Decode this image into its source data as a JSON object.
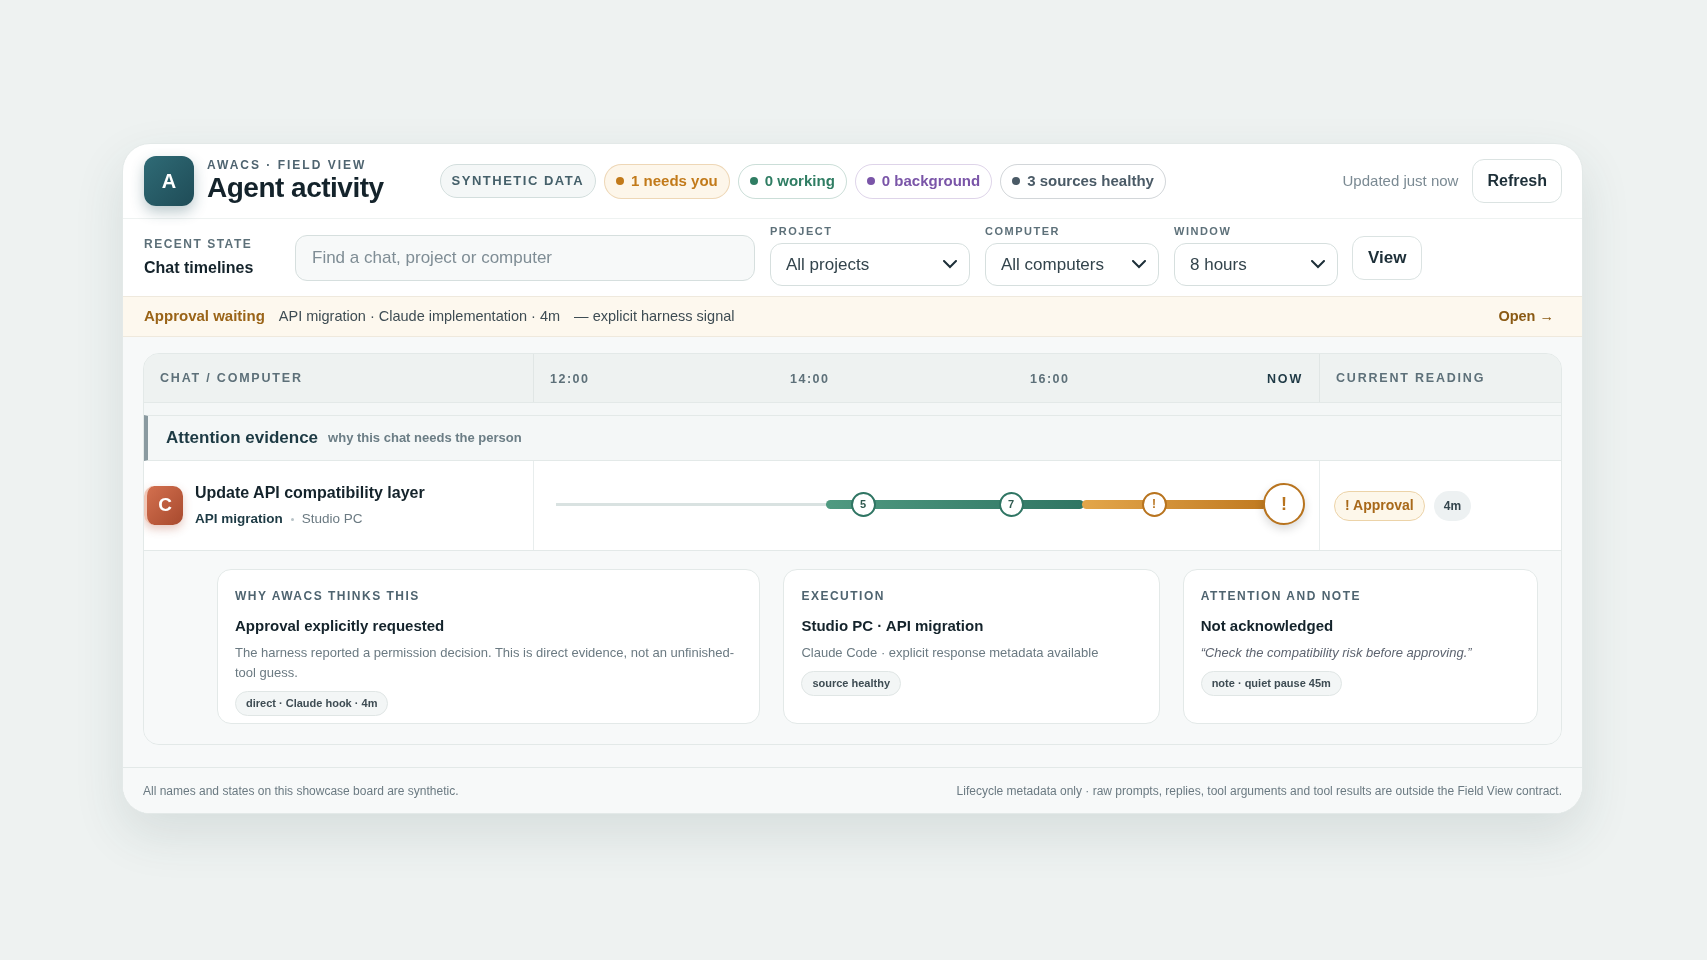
{
  "header": {
    "logo_letter": "A",
    "eyebrow": "AWACS · FIELD VIEW",
    "title": "Agent activity",
    "pills": [
      {
        "kind": "tag",
        "label": "SYNTHETIC DATA"
      },
      {
        "kind": "status",
        "label": "1 needs you",
        "color": "#c27a1a"
      },
      {
        "kind": "status",
        "label": "0 working",
        "color": "#2f7d63"
      },
      {
        "kind": "status",
        "label": "0 background",
        "color": "#7a55a8"
      },
      {
        "kind": "status",
        "label": "3 sources healthy",
        "color": "#4a5a66"
      }
    ],
    "updated": "Updated just now",
    "refresh_button": "Refresh"
  },
  "filters": {
    "eyebrow": "RECENT STATE",
    "title": "Chat timelines",
    "search": {
      "placeholder": "Find a chat, project or computer"
    },
    "selects": [
      {
        "label": "PROJECT",
        "value": "All projects"
      },
      {
        "label": "COMPUTER",
        "value": "All computers"
      },
      {
        "label": "WINDOW",
        "value": "8 hours"
      }
    ],
    "view_button": "View"
  },
  "alert": {
    "title": "Approval waiting",
    "detail": "API migration · Claude implementation · 4m",
    "note": "— explicit harness signal",
    "link": "Open →"
  },
  "table": {
    "columns": [
      "CHAT / COMPUTER",
      "CURRENT READING"
    ],
    "ticks": [
      {
        "label": "12:00",
        "kind": "time"
      },
      {
        "label": "14:00",
        "kind": "time"
      },
      {
        "label": "16:00",
        "kind": "time"
      },
      {
        "label": "NOW",
        "kind": "now"
      }
    ],
    "section": {
      "title": "Attention evidence",
      "subtitle": "why this chat needs the person"
    },
    "rows": [
      {
        "avatar": "C",
        "title": "Update API compatibility layer",
        "project": "API migration",
        "computer": "Studio PC",
        "segments": [
          {
            "kind": "idle"
          },
          {
            "kind": "working"
          },
          {
            "kind": "waiting"
          }
        ],
        "markers": [
          {
            "kind": "working",
            "label": "5"
          },
          {
            "kind": "working",
            "label": "7"
          },
          {
            "kind": "waiting",
            "label": "!"
          },
          {
            "kind": "current",
            "label": "!"
          }
        ],
        "reading": {
          "badge": "! Approval",
          "age": "4m"
        },
        "cards": [
          {
            "eyebrow": "WHY AWACS THINKS THIS",
            "title": "Approval explicitly requested",
            "body": "The harness reported a permission decision. This is direct evidence, not an unfinished-tool guess.",
            "italic": false,
            "tag": "direct · Claude hook · 4m"
          },
          {
            "eyebrow": "EXECUTION",
            "title": "Studio PC · API migration",
            "body": "Claude Code · explicit response metadata available",
            "italic": false,
            "tag": "source healthy"
          },
          {
            "eyebrow": "ATTENTION AND NOTE",
            "title": "Not acknowledged",
            "body": "“Check the compatibility risk before approving.”",
            "italic": true,
            "tag": "note · quiet pause 45m"
          }
        ]
      }
    ]
  },
  "footer": {
    "left": "All names and states on this showcase board are synthetic.",
    "right": "Lifecycle metadata only · raw prompts, replies, tool arguments and tool results are outside the Field View contract."
  }
}
